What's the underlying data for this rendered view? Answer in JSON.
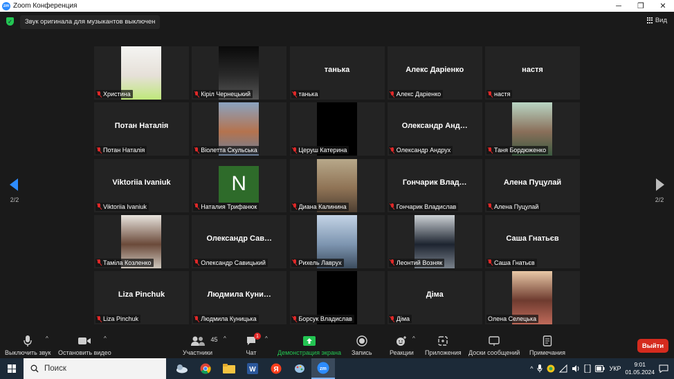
{
  "window": {
    "title": "Zoom Конференция"
  },
  "window_controls": {
    "minimize": "─",
    "restore": "❐",
    "close": "✕"
  },
  "notice": {
    "text": "Звук оригинала для музыкантов выключен"
  },
  "view": {
    "label": "Вид"
  },
  "tiles": [
    {
      "display": "photo",
      "label": "Христина",
      "photo": [
        "#f4f4f2",
        "#e6e0d8",
        "#bfe87a"
      ]
    },
    {
      "display": "photo",
      "label": "Кiрiл Чернецький",
      "photo": [
        "#0a0a0a",
        "#2a2a2a",
        "#555555"
      ]
    },
    {
      "display": "name",
      "name": "танька",
      "label": "танька"
    },
    {
      "display": "name",
      "name": "Алекс Дарiенко",
      "label": "Алекс Дарiенко"
    },
    {
      "display": "name",
      "name": "настя",
      "label": "настя"
    },
    {
      "display": "name",
      "name": "Потан Наталія",
      "label": "Потан Наталія"
    },
    {
      "display": "photo",
      "label": "Віолетта Скульська",
      "photo": [
        "#8aa3c0",
        "#b5734e",
        "#6a7f9a"
      ]
    },
    {
      "display": "photo",
      "label": "Церуш Катерина",
      "photo": [
        "#000000",
        "#000000",
        "#000000"
      ]
    },
    {
      "display": "name",
      "name": "Олександр Анд…",
      "label": "Олександр Андрух"
    },
    {
      "display": "photo",
      "label": "Таня Бордюженко",
      "photo": [
        "#b9d6c4",
        "#8a6f5a",
        "#3a5a40"
      ]
    },
    {
      "display": "name",
      "name": "Viktoriia Ivaniuk",
      "label": "Viktoriia Ivaniuk"
    },
    {
      "display": "avatar",
      "avatar_letter": "N",
      "label": "Наталия Трифанюк"
    },
    {
      "display": "photo",
      "label": "Диана Калинина",
      "photo": [
        "#b7a88a",
        "#8f7355",
        "#4d3f32"
      ]
    },
    {
      "display": "name",
      "name": "Гончарик Влад…",
      "label": "Гончарик Владислав"
    },
    {
      "display": "name",
      "name": "Алена Пуцулай",
      "label": "Алена Пуцулай"
    },
    {
      "display": "photo",
      "label": "Таміла Козленко",
      "photo": [
        "#e8e4de",
        "#6b4a3a",
        "#cfc8be"
      ]
    },
    {
      "display": "name",
      "name": "Олександр Сав…",
      "label": "Олександр Савицький"
    },
    {
      "display": "photo",
      "label": "Рихель Лаврух",
      "photo": [
        "#c4d4e6",
        "#7d95b0",
        "#3c4c5e"
      ]
    },
    {
      "display": "photo",
      "label": "Леонтий Возняк",
      "photo": [
        "#cdd2d6",
        "#1d2430",
        "#7a828c"
      ]
    },
    {
      "display": "name",
      "name": "Саша Гнатьєв",
      "label": "Саша Гнатьєв"
    },
    {
      "display": "name",
      "name": "Liza Pinchuk",
      "label": "Liza Pinchuk"
    },
    {
      "display": "name",
      "name": "Людмила Куни…",
      "label": "Людмила Куницька"
    },
    {
      "display": "photo",
      "label": "Борсук Владислав",
      "photo": [
        "#000000",
        "#000000",
        "#000000"
      ]
    },
    {
      "display": "name",
      "name": "Діма",
      "label": "Діма"
    },
    {
      "display": "photo",
      "label": "Олена Селецька",
      "photo": [
        "#e9c9a7",
        "#6e3b2f",
        "#c06a5a"
      ],
      "muted": false
    }
  ],
  "paging": {
    "left": "2/2",
    "right": "2/2"
  },
  "toolbar": {
    "mute": "Выключить звук",
    "video": "Остановить видео",
    "participants": "Участники",
    "participants_count": "45",
    "chat": "Чат",
    "chat_badge": "1",
    "share": "Демонстрация экрана",
    "record": "Запись",
    "reactions": "Реакции",
    "apps": "Приложения",
    "whiteboards": "Доски сообщений",
    "notes": "Примечания",
    "leave": "Выйти"
  },
  "taskbar": {
    "search": "Поиск",
    "lang": "УКР",
    "time": "9:01",
    "date": "01.05.2024"
  },
  "colors": {
    "accent": "#2d8cff",
    "leave": "#d52b1e",
    "share": "#23c552",
    "muted_mic": "#e02828"
  }
}
